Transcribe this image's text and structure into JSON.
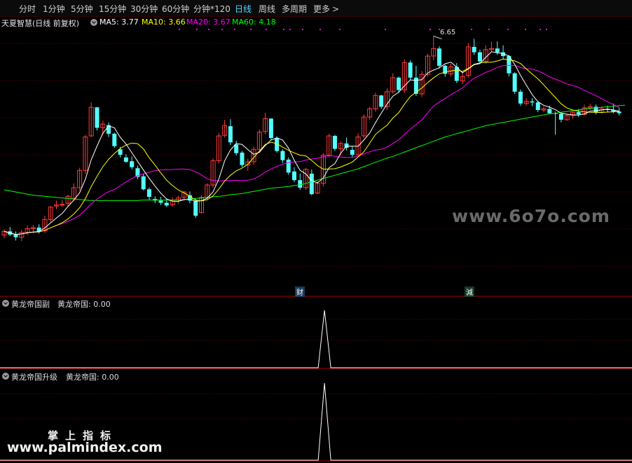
{
  "toolbar": {
    "items": [
      {
        "label": "分时",
        "active": false
      },
      {
        "label": "1分钟",
        "active": false
      },
      {
        "label": "5分钟",
        "active": false
      },
      {
        "label": "15分钟",
        "active": false
      },
      {
        "label": "30分钟",
        "active": false
      },
      {
        "label": "60分钟",
        "active": false
      },
      {
        "label": "分钟*120",
        "active": false
      },
      {
        "label": "日线",
        "active": true
      },
      {
        "label": "周线",
        "active": false
      },
      {
        "label": "多周期",
        "active": false
      },
      {
        "label": "更多",
        "active": false
      }
    ],
    "more_icon": "chevron-right-icon"
  },
  "stock_header": {
    "name": "天夏智慧(日线 前复权)",
    "settings_icon": "chevron-down-circle-icon",
    "ma": [
      {
        "label": "MA5: 3.77",
        "color": "#ffffff"
      },
      {
        "label": "MA10: 3.66",
        "color": "#ffff00"
      },
      {
        "label": "MA20: 3.67",
        "color": "#ff00ff"
      },
      {
        "label": "MA60: 4.18",
        "color": "#00ff00"
      }
    ]
  },
  "colors": {
    "up": "#ff3b3b",
    "down": "#54ffff",
    "ma5": "#ffffff",
    "ma10": "#ffff00",
    "ma20": "#ff00ff",
    "ma60": "#00ff00",
    "grid": "#7a0000",
    "divider": "#b00000"
  },
  "markers": {
    "high_label": "6.65",
    "cai": "财",
    "jian": "減"
  },
  "chart_data": {
    "type": "candlestick",
    "price_high_label": 6.65,
    "ma_values": {
      "MA5": 3.77,
      "MA10": 3.66,
      "MA20": 3.67,
      "MA60": 4.18
    },
    "ohlc": [
      [
        2.96,
        3.07,
        2.9,
        3.03
      ],
      [
        3.03,
        3.11,
        2.94,
        2.97
      ],
      [
        2.98,
        3.03,
        2.86,
        2.92
      ],
      [
        2.92,
        3.06,
        2.85,
        3.01
      ],
      [
        3.01,
        3.14,
        2.96,
        3.08
      ],
      [
        3.08,
        3.15,
        3.0,
        3.1
      ],
      [
        3.1,
        3.16,
        2.99,
        3.03
      ],
      [
        3.04,
        3.32,
        3.0,
        3.25
      ],
      [
        3.25,
        3.5,
        3.2,
        3.48
      ],
      [
        3.5,
        3.6,
        3.44,
        3.52
      ],
      [
        3.52,
        3.61,
        3.48,
        3.53
      ],
      [
        3.55,
        3.71,
        3.48,
        3.68
      ],
      [
        3.64,
        3.92,
        3.59,
        3.84
      ],
      [
        3.84,
        4.21,
        3.79,
        4.16
      ],
      [
        4.16,
        4.82,
        4.09,
        4.78
      ],
      [
        4.8,
        5.42,
        4.78,
        5.33
      ],
      [
        5.33,
        5.33,
        4.9,
        4.95
      ],
      [
        4.95,
        5.08,
        4.82,
        5.02
      ],
      [
        5.0,
        5.05,
        4.78,
        4.84
      ],
      [
        4.84,
        4.86,
        4.58,
        4.61
      ],
      [
        4.55,
        4.6,
        4.4,
        4.45
      ],
      [
        4.4,
        4.46,
        4.3,
        4.32
      ],
      [
        4.33,
        4.42,
        4.18,
        4.22
      ],
      [
        4.2,
        4.25,
        4.0,
        4.04
      ],
      [
        4.05,
        4.1,
        3.79,
        3.81
      ],
      [
        3.81,
        3.84,
        3.61,
        3.67
      ],
      [
        3.63,
        3.68,
        3.55,
        3.6
      ],
      [
        3.6,
        3.67,
        3.52,
        3.56
      ],
      [
        3.56,
        3.64,
        3.48,
        3.51
      ],
      [
        3.52,
        3.66,
        3.49,
        3.61
      ],
      [
        3.61,
        3.69,
        3.54,
        3.65
      ],
      [
        3.66,
        3.78,
        3.6,
        3.76
      ],
      [
        3.7,
        3.77,
        3.55,
        3.6
      ],
      [
        3.6,
        3.64,
        3.28,
        3.32
      ],
      [
        3.38,
        3.7,
        3.36,
        3.66
      ],
      [
        3.66,
        3.92,
        3.62,
        3.89
      ],
      [
        3.89,
        4.38,
        3.84,
        4.34
      ],
      [
        4.34,
        4.85,
        4.29,
        4.8
      ],
      [
        4.81,
        5.1,
        4.77,
        4.99
      ],
      [
        4.98,
        5.11,
        4.63,
        4.68
      ],
      [
        4.64,
        4.71,
        4.44,
        4.48
      ],
      [
        4.49,
        4.52,
        4.22,
        4.26
      ],
      [
        4.26,
        4.38,
        4.15,
        4.32
      ],
      [
        4.32,
        4.6,
        4.26,
        4.55
      ],
      [
        4.55,
        4.92,
        4.52,
        4.87
      ],
      [
        4.88,
        5.23,
        4.83,
        5.12
      ],
      [
        5.12,
        5.13,
        4.72,
        4.76
      ],
      [
        4.76,
        4.79,
        4.49,
        4.52
      ],
      [
        4.52,
        4.55,
        4.3,
        4.35
      ],
      [
        4.36,
        4.4,
        4.08,
        4.12
      ],
      [
        4.14,
        4.22,
        3.94,
        3.98
      ],
      [
        3.98,
        4.1,
        3.8,
        3.84
      ],
      [
        3.84,
        4.2,
        3.8,
        4.18
      ],
      [
        4.1,
        4.18,
        3.7,
        3.72
      ],
      [
        3.74,
        3.96,
        3.72,
        3.92
      ],
      [
        3.92,
        4.48,
        3.86,
        4.44
      ],
      [
        4.44,
        4.84,
        4.4,
        4.8
      ],
      [
        4.8,
        4.82,
        4.52,
        4.56
      ],
      [
        4.56,
        4.7,
        4.44,
        4.66
      ],
      [
        4.66,
        4.77,
        4.53,
        4.58
      ],
      [
        4.54,
        4.6,
        4.4,
        4.45
      ],
      [
        4.45,
        4.85,
        4.41,
        4.78
      ],
      [
        4.8,
        5.2,
        4.76,
        5.15
      ],
      [
        5.15,
        5.34,
        5.1,
        5.3
      ],
      [
        5.3,
        5.6,
        5.25,
        5.55
      ],
      [
        5.55,
        5.56,
        5.3,
        5.34
      ],
      [
        5.34,
        5.68,
        5.28,
        5.62
      ],
      [
        5.62,
        5.96,
        5.58,
        5.88
      ],
      [
        5.88,
        5.9,
        5.6,
        5.65
      ],
      [
        5.65,
        6.22,
        5.6,
        6.16
      ],
      [
        6.16,
        6.2,
        5.84,
        5.88
      ],
      [
        5.88,
        6.1,
        5.54,
        5.58
      ],
      [
        5.58,
        6.0,
        5.52,
        5.94
      ],
      [
        5.94,
        6.32,
        5.9,
        6.28
      ],
      [
        6.28,
        6.65,
        6.2,
        6.42
      ],
      [
        6.42,
        6.46,
        6.05,
        6.1
      ],
      [
        6.1,
        6.12,
        5.9,
        5.95
      ],
      [
        5.95,
        6.14,
        5.9,
        6.08
      ],
      [
        6.08,
        6.15,
        5.78,
        5.82
      ],
      [
        5.82,
        5.98,
        5.76,
        5.9
      ],
      [
        5.92,
        6.52,
        5.88,
        6.45
      ],
      [
        6.45,
        6.6,
        6.3,
        6.35
      ],
      [
        6.35,
        6.4,
        6.14,
        6.18
      ],
      [
        6.18,
        6.48,
        6.14,
        6.4
      ],
      [
        6.4,
        6.55,
        6.36,
        6.42
      ],
      [
        6.42,
        6.55,
        6.3,
        6.35
      ],
      [
        6.35,
        6.48,
        6.22,
        6.28
      ],
      [
        6.28,
        6.3,
        5.9,
        5.96
      ],
      [
        5.96,
        5.98,
        5.58,
        5.62
      ],
      [
        5.62,
        5.66,
        5.36,
        5.4
      ],
      [
        5.4,
        5.5,
        5.36,
        5.44
      ],
      [
        5.44,
        5.5,
        5.35,
        5.42
      ],
      [
        5.42,
        5.45,
        5.24,
        5.28
      ],
      [
        5.28,
        5.35,
        5.24,
        5.3
      ],
      [
        5.3,
        5.36,
        5.2,
        5.22
      ],
      [
        5.22,
        5.25,
        4.82,
        5.21
      ],
      [
        5.21,
        5.23,
        5.05,
        5.1
      ],
      [
        5.1,
        5.2,
        5.08,
        5.18
      ],
      [
        5.18,
        5.26,
        5.12,
        5.24
      ],
      [
        5.24,
        5.3,
        5.15,
        5.2
      ],
      [
        5.2,
        5.38,
        5.18,
        5.32
      ],
      [
        5.32,
        5.4,
        5.28,
        5.34
      ],
      [
        5.34,
        5.38,
        5.2,
        5.24
      ],
      [
        5.24,
        5.35,
        5.21,
        5.3
      ],
      [
        5.3,
        5.36,
        5.24,
        5.28
      ],
      [
        5.28,
        5.4,
        5.22,
        5.25
      ],
      [
        5.25,
        5.32,
        5.18,
        5.22
      ]
    ],
    "ma60": [
      3.8,
      3.78,
      3.76,
      3.74,
      3.72,
      3.7,
      3.69,
      3.68,
      3.67,
      3.66,
      3.65,
      3.64,
      3.63,
      3.62,
      3.61,
      3.6,
      3.6,
      3.6,
      3.6,
      3.6,
      3.6,
      3.6,
      3.6,
      3.6,
      3.61,
      3.61,
      3.61,
      3.61,
      3.61,
      3.61,
      3.61,
      3.62,
      3.63,
      3.64,
      3.65,
      3.66,
      3.67,
      3.68,
      3.69,
      3.71,
      3.72,
      3.73,
      3.75,
      3.77,
      3.79,
      3.81,
      3.83,
      3.84,
      3.85,
      3.86,
      3.88,
      3.89,
      3.92,
      3.95,
      3.98,
      4.01,
      4.04,
      4.07,
      4.1,
      4.13,
      4.16,
      4.19,
      4.23,
      4.27,
      4.31,
      4.35,
      4.39,
      4.42,
      4.46,
      4.5,
      4.54,
      4.58,
      4.62,
      4.66,
      4.7,
      4.74,
      4.78,
      4.81,
      4.84,
      4.87,
      4.9,
      4.93,
      4.96,
      4.99,
      5.01,
      5.03,
      5.05,
      5.07,
      5.09,
      5.11,
      5.13,
      5.15,
      5.17,
      5.19,
      5.21,
      5.22,
      5.24,
      5.25,
      5.27,
      5.28,
      5.3,
      5.31,
      5.32,
      5.33,
      5.34,
      5.35,
      5.36,
      5.37
    ]
  },
  "indicator1": {
    "title": "黄龙帝国副",
    "series_label": "黄龙帝国: 0.00",
    "chart_data": {
      "type": "line",
      "spike_bar": 54,
      "spike_value": 1,
      "base_value": 0
    }
  },
  "indicator2": {
    "title": "黄龙帝国升级",
    "series_label": "黄龙帝国: 0.00",
    "chart_data": {
      "type": "line",
      "spike_bar": 54,
      "spike_value": 1,
      "base_value": 0
    }
  },
  "watermarks": {
    "site": "www.6o7o.com",
    "cn": "掌上指标",
    "url": "www.palmindex.com"
  }
}
